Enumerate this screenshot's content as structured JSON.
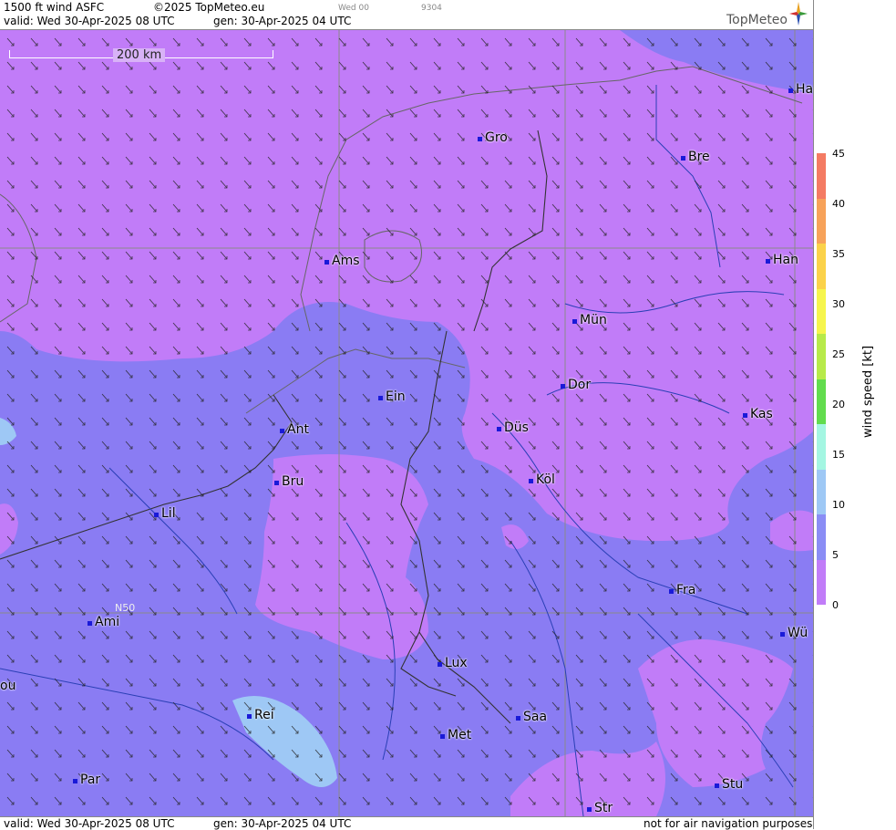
{
  "header": {
    "title": "1500 ft wind ASFC",
    "copyright": "©2025 TopMeteo.eu",
    "small_tag": "Wed 00",
    "small_code": "9304",
    "valid": "valid:  Wed  30-Apr-2025  08 UTC",
    "gen": "gen: 30-Apr-2025 04 UTC",
    "brand": "TopMeteo"
  },
  "map": {
    "scale_label": "200 km",
    "graticule_label": "N50",
    "cities": [
      {
        "label": "Ha"
      },
      {
        "label": "Gro"
      },
      {
        "label": "Bre"
      },
      {
        "label": "Ams"
      },
      {
        "label": "Han"
      },
      {
        "label": "Mün"
      },
      {
        "label": "Ein"
      },
      {
        "label": "Dor"
      },
      {
        "label": "Kas"
      },
      {
        "label": "Ant"
      },
      {
        "label": "Düs"
      },
      {
        "label": "Bru"
      },
      {
        "label": "Köl"
      },
      {
        "label": "Lil"
      },
      {
        "label": "Fra"
      },
      {
        "label": "Ami"
      },
      {
        "label": "Wü"
      },
      {
        "label": "Lux"
      },
      {
        "label": "ou"
      },
      {
        "label": "Rei"
      },
      {
        "label": "Saa"
      },
      {
        "label": "Met"
      },
      {
        "label": "Par"
      },
      {
        "label": "Stu"
      },
      {
        "label": "Str"
      }
    ]
  },
  "legend": {
    "unit": "wind speed  [kt]",
    "ticks": [
      "45",
      "40",
      "35",
      "30",
      "25",
      "20",
      "15",
      "10",
      "5",
      "0"
    ],
    "colors": [
      "#f47b63",
      "#f7a25a",
      "#fbd24a",
      "#f6f54d",
      "#b7ea4a",
      "#62dc4e",
      "#a4f6e2",
      "#9ec8f5",
      "#8a8df5",
      "#c17cf8"
    ]
  },
  "footer": {
    "valid": "valid:  Wed  30-Apr-2025  08 UTC",
    "gen": "gen: 30-Apr-2025 04 UTC",
    "disclaimer": "not for air navigation purposes"
  }
}
